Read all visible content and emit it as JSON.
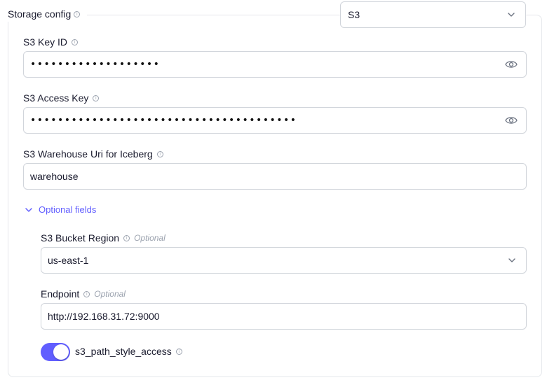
{
  "storage_config": {
    "label": "Storage config",
    "selected": "S3"
  },
  "s3_key_id": {
    "label": "S3 Key ID",
    "masked_value": "•••••••••••••••••••"
  },
  "s3_access_key": {
    "label": "S3 Access Key",
    "masked_value": "•••••••••••••••••••••••••••••••••••••••"
  },
  "warehouse_uri": {
    "label": "S3 Warehouse Uri for Iceberg",
    "value": "warehouse"
  },
  "optional_fields": {
    "label": "Optional fields",
    "expanded": true,
    "bucket_region": {
      "label": "S3 Bucket Region",
      "optional_label": "Optional",
      "selected": "us-east-1"
    },
    "endpoint": {
      "label": "Endpoint",
      "optional_label": "Optional",
      "value": "http://192.168.31.72:9000"
    },
    "path_style_access": {
      "label": "s3_path_style_access",
      "enabled": true
    }
  },
  "colors": {
    "accent": "#615eff",
    "border": "#d1d5db",
    "text": "#1a1b2e",
    "muted": "#9ca3af"
  },
  "icons": [
    "info-icon",
    "eye-icon",
    "chevron-down-icon"
  ]
}
